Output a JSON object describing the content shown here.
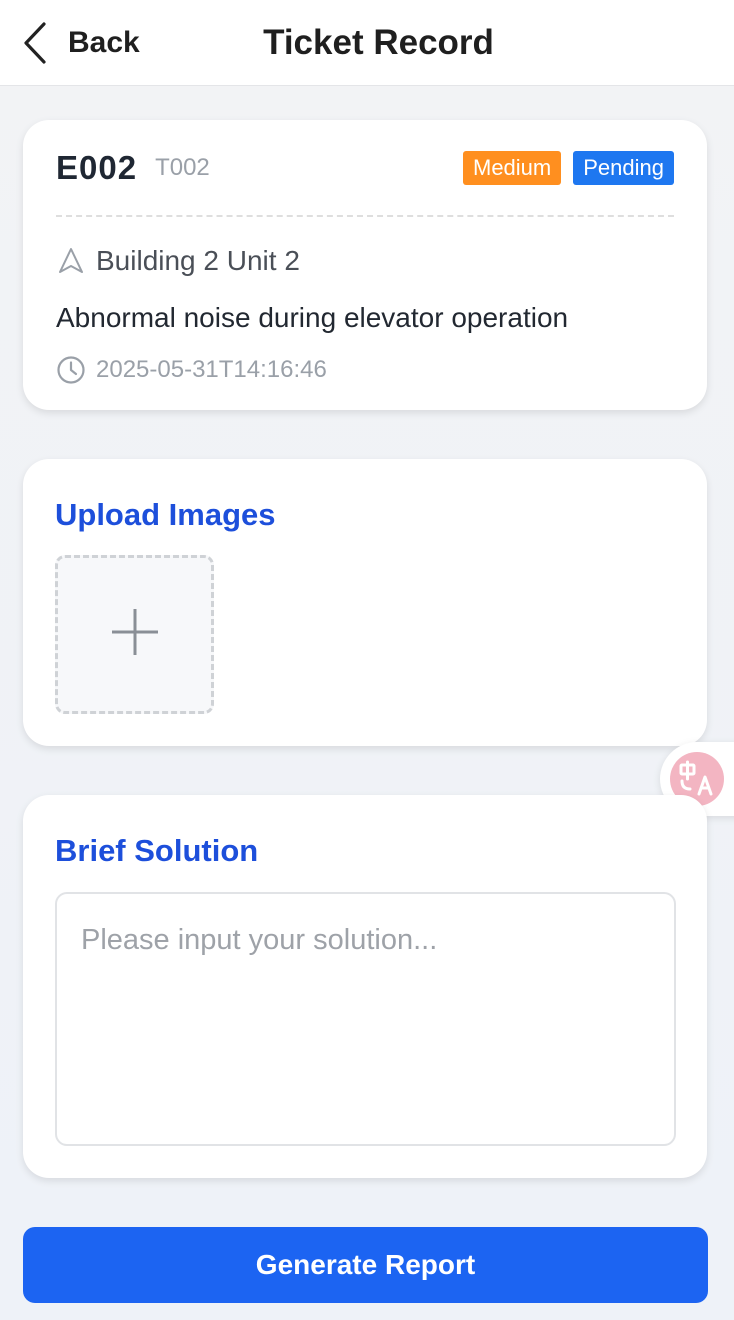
{
  "header": {
    "back_label": "Back",
    "title": "Ticket Record"
  },
  "ticket": {
    "id": "E002",
    "code": "T002",
    "priority": "Medium",
    "status": "Pending",
    "location": "Building 2 Unit 2",
    "description": "Abnormal noise during elevator operation",
    "timestamp": "2025-05-31T14:16:46"
  },
  "upload": {
    "title": "Upload Images"
  },
  "solution": {
    "title": "Brief Solution",
    "placeholder": "Please input your solution...",
    "value": ""
  },
  "actions": {
    "generate_label": "Generate Report"
  },
  "colors": {
    "accent": "#1c64f2",
    "section_title": "#1d4fdb",
    "priority_badge": "#ff8f1f",
    "status_badge": "#1e77f0"
  },
  "icons": {
    "back": "chevron-left-icon",
    "location": "navigation-arrow-icon",
    "time": "clock-icon",
    "upload": "plus-icon",
    "translate": "translate-icon"
  }
}
